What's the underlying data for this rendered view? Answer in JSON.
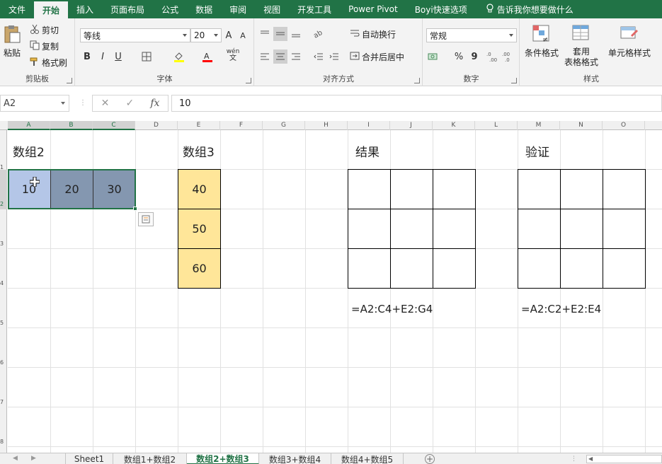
{
  "ribbon_tabs": [
    "文件",
    "开始",
    "插入",
    "页面布局",
    "公式",
    "数据",
    "审阅",
    "视图",
    "开发工具",
    "Power Pivot",
    "Boyi快速选项"
  ],
  "active_tab": "开始",
  "tell_me": "告诉我你想要做什么",
  "clipboard": {
    "paste": "粘贴",
    "cut": "剪切",
    "copy": "复制",
    "format_painter": "格式刷",
    "label": "剪贴板"
  },
  "font": {
    "name": "等线",
    "size": "20",
    "bold": "B",
    "italic": "I",
    "underline": "U",
    "phonetic": "wén",
    "label": "字体"
  },
  "alignment": {
    "wrap": "自动换行",
    "merge": "合并后居中",
    "label": "对齐方式"
  },
  "number": {
    "format": "常规",
    "percent": "%",
    "comma": "9",
    "label": "数字"
  },
  "styles": {
    "conditional": "条件格式",
    "table_line1": "套用",
    "table_line2": "表格格式",
    "cell_styles": "单元格样式",
    "label": "样式"
  },
  "formula_bar": {
    "name_box": "A2",
    "fx": "fx",
    "value": "10"
  },
  "columns": [
    "A",
    "B",
    "C",
    "D",
    "E",
    "F",
    "G",
    "H",
    "I",
    "J",
    "K",
    "L",
    "M",
    "N",
    "O"
  ],
  "rows": [
    "1",
    "2",
    "3",
    "4",
    "5",
    "6",
    "7",
    "8"
  ],
  "cells": {
    "a1": "数组2",
    "e1": "数组3",
    "i1": "结果",
    "m1": "验证",
    "a2": "10",
    "b2": "20",
    "c2": "30",
    "e2": "40",
    "e3": "50",
    "e4": "60",
    "formula_result": "=A2:C4+E2:G4",
    "formula_verify": "=A2:C2+E2:E4"
  },
  "sheet_tabs": [
    "Sheet1",
    "数组1+数组2",
    "数组2+数组3",
    "数组3+数组4",
    "数组4+数组5"
  ],
  "active_sheet": "数组2+数组3",
  "colors": {
    "excel_green": "#217346",
    "sel_light": "#b4c6e7",
    "sel_dark": "#8497b0",
    "yellow": "#ffe699"
  }
}
